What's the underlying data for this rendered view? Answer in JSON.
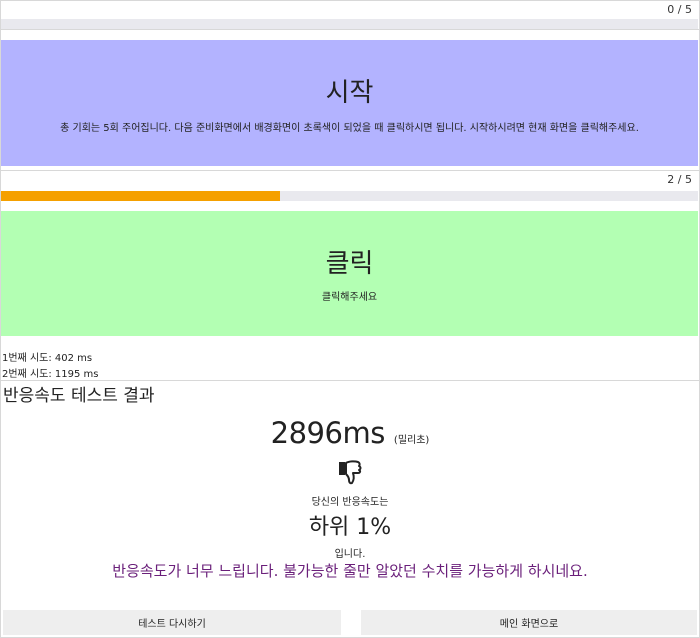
{
  "start_screen": {
    "counter": "0 / 5",
    "progress": 0,
    "title": "시작",
    "description": "총 기회는 5회 주어집니다. 다음 준비화면에서 배경화면이 초록색이 되었을 때 클릭하시면 됩니다. 시작하시려면 현재 화면을 클릭해주세요.",
    "background": "#b3b3ff"
  },
  "click_screen": {
    "counter": "2 / 5",
    "progress": 0.4,
    "progress_color": "#f5a000",
    "title": "클릭",
    "description": "클릭해주세요",
    "background": "#b3ffb3"
  },
  "attempts": [
    "1번째 시도: 402 ms",
    "2번째 시도: 1195 ms"
  ],
  "result": {
    "title": "반응속도 테스트 결과",
    "ms_value": "2896ms",
    "ms_unit": "(밀리초)",
    "icon": "thumbs-down-icon",
    "your_speed_label": "당신의 반응속도는",
    "rank": "하위 1%",
    "rank_suffix": "입니다.",
    "message": "반응속도가 너무 느립니다. 불가능한 줄만 알았던 수치를 가능하게 하시네요.",
    "message_color": "#6a1f7a"
  },
  "buttons": {
    "retry": "테스트 다시하기",
    "home": "메인 화면으로"
  }
}
